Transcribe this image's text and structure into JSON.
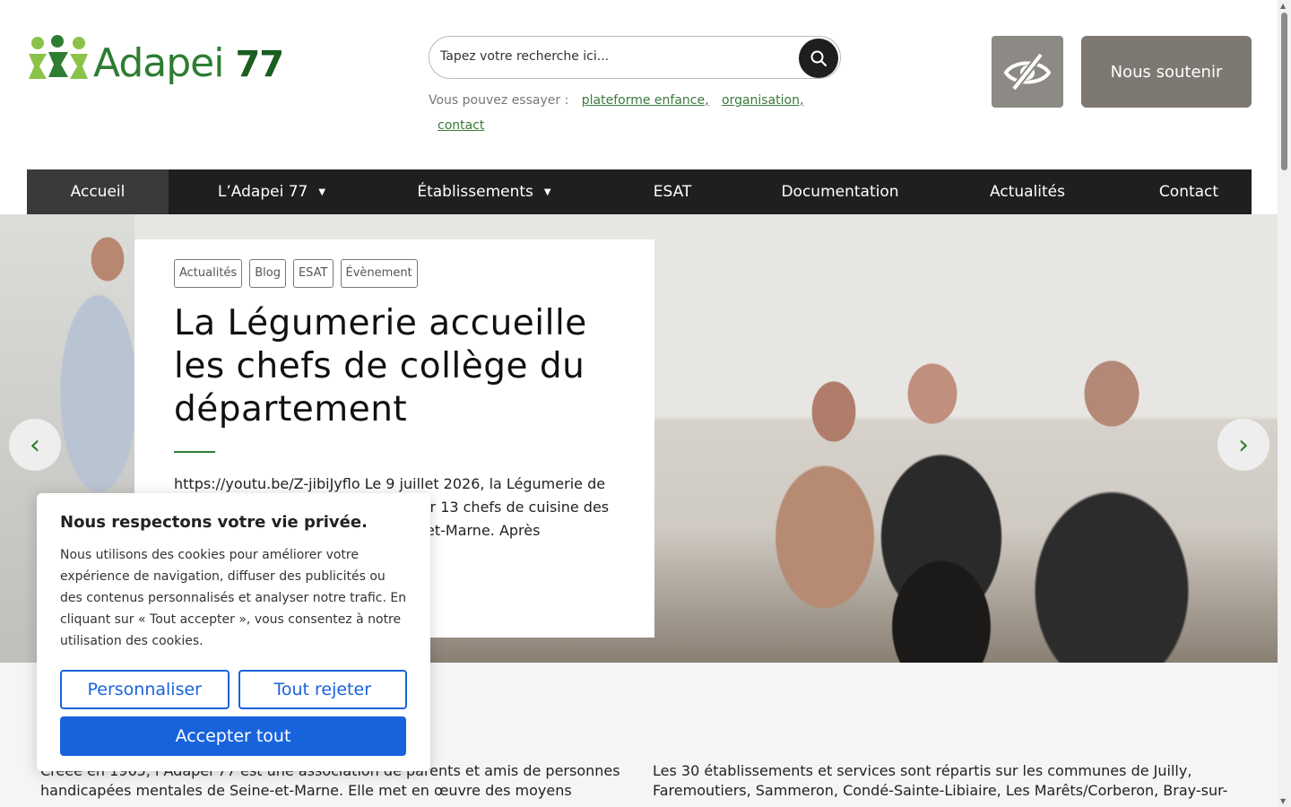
{
  "header": {
    "logo": {
      "text": "Adapei",
      "number": "77",
      "icon": "people-logo-icon"
    },
    "search": {
      "placeholder": "Tapez votre recherche ici...",
      "button_icon": "search-icon"
    },
    "suggestions": {
      "prefix": "Vous pouvez essayer :",
      "links": [
        "plateforme enfance,",
        "organisation,",
        "contact"
      ]
    },
    "accessibility_icon": "eye-slash-icon",
    "support_label": "Nous soutenir"
  },
  "nav": {
    "items": [
      {
        "label": "Accueil",
        "active": true,
        "dropdown": false
      },
      {
        "label": "L’Adapei 77",
        "active": false,
        "dropdown": true
      },
      {
        "label": "Établissements",
        "active": false,
        "dropdown": true
      },
      {
        "label": "ESAT",
        "active": false,
        "dropdown": false
      },
      {
        "label": "Documentation",
        "active": false,
        "dropdown": false
      },
      {
        "label": "Actualités",
        "active": false,
        "dropdown": false
      },
      {
        "label": "Contact",
        "active": false,
        "dropdown": false
      }
    ]
  },
  "hero": {
    "tags": [
      "Actualités",
      "Blog",
      "ESAT",
      "Évènement"
    ],
    "title": "La Légumerie accueille les chefs de collège du département",
    "excerpt": "https://youtu.be/Z-jibiJyflo Le 9 juillet 2026, la Légumerie de notre ESAT a eu le plaisir d’accueillir 13 chefs de cuisine des collèges du département de Seine-et-Marne. Après",
    "prev_icon": "chevron-left-icon",
    "next_icon": "chevron-right-icon"
  },
  "intro": {
    "left": "Créée en 1965, l’Adapei 77 est une association de parents et amis de personnes handicapées mentales de Seine-et-Marne. Elle met en œuvre des moyens",
    "right": "Les 30 établissements et services sont répartis sur les communes de Juilly, Faremoutiers, Sammeron, Condé-Sainte-Libiaire, Les Marêts/Corberon, Bray-sur-"
  },
  "cookie": {
    "title": "Nous respectons votre vie privée.",
    "text": "Nous utilisons des cookies pour améliorer votre expérience de navigation, diffuser des publicités ou des contenus personnalisés et analyser notre trafic. En cliquant sur « Tout accepter », vous consentez à notre utilisation des cookies.",
    "customize": "Personnaliser",
    "reject": "Tout rejeter",
    "accept": "Accepter tout"
  },
  "colors": {
    "brand_green": "#2e7d32",
    "nav_bg": "#1f1f1f",
    "support_bg": "#7d7872",
    "cookie_blue": "#1863dc"
  }
}
